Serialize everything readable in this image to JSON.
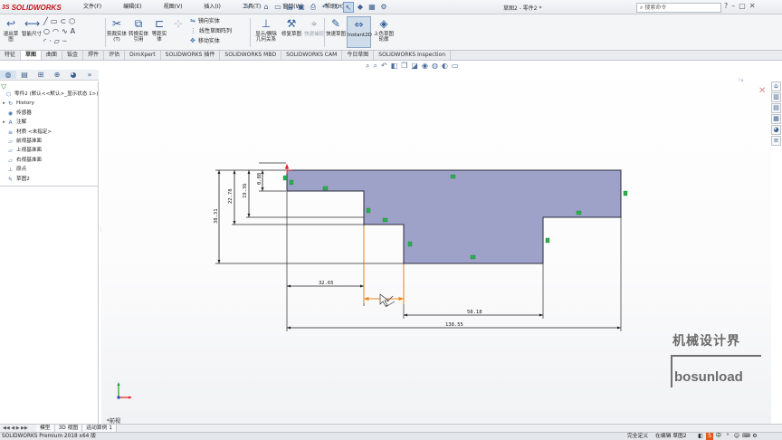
{
  "app": {
    "logo_ds": "3S",
    "logo_text": "SOLIDWORKS",
    "window_title": "草图2 - 零件2 *",
    "search_placeholder": "搜索命令"
  },
  "menu": [
    "文件(F)",
    "编辑(E)",
    "视图(V)",
    "插入(I)",
    "工具(T)",
    "窗口(W)",
    "帮助(H)"
  ],
  "command_manager": {
    "exit_sketch": "退出草图",
    "smart_dimension": "智能尺寸",
    "trim": "剪裁实体(T)",
    "convert": "转换实体引用",
    "offset": "等距实体",
    "mirror": "镜向实体",
    "linear_pattern": "线性草图阵列",
    "move": "移动实体",
    "display_relations": "显示/删除几何关系",
    "repair": "修复草图",
    "quick_snap": "快速捕捉",
    "rapid_sketch": "快速草图",
    "instant2d": "Instant2D",
    "shaded_contours": "上色草图轮廓"
  },
  "tabs": [
    "特征",
    "草图",
    "曲面",
    "钣金",
    "焊件",
    "评估",
    "DimXpert",
    "SOLIDWORKS 插件",
    "SOLIDWORKS MBD",
    "SOLIDWORKS CAM",
    "今日草图",
    "SOLIDWORKS Inspection"
  ],
  "active_tab_index": 1,
  "feature_tree": [
    {
      "label": "零件2 (默认<<默认>_显示状态 1>)",
      "icon": "part-icon",
      "glyph": "⬡",
      "exp": ""
    },
    {
      "label": "History",
      "icon": "history-icon",
      "glyph": "↻",
      "exp": "▸"
    },
    {
      "label": "传感器",
      "icon": "sensor-icon",
      "glyph": "◉",
      "exp": ""
    },
    {
      "label": "注解",
      "icon": "annotation-icon",
      "glyph": "A",
      "exp": "▸"
    },
    {
      "label": "材质 <未指定>",
      "icon": "material-icon",
      "glyph": "≡",
      "exp": ""
    },
    {
      "label": "前视基准面",
      "icon": "plane-icon",
      "glyph": "▱",
      "exp": ""
    },
    {
      "label": "上视基准面",
      "icon": "plane-icon",
      "glyph": "▱",
      "exp": ""
    },
    {
      "label": "右视基准面",
      "icon": "plane-icon",
      "glyph": "▱",
      "exp": ""
    },
    {
      "label": "原点",
      "icon": "origin-icon",
      "glyph": "⊥",
      "exp": ""
    },
    {
      "label": "草图2",
      "icon": "sketch-icon",
      "glyph": "✎",
      "exp": ""
    }
  ],
  "dimensions": {
    "d_0_88": "0.88",
    "d_19_36": "19.36",
    "d_22_78": "22.78",
    "d_38_31": "38.31",
    "d_32_65": "32.65",
    "d_58_18": "58.18",
    "d_138_55": "138.55"
  },
  "watermark": {
    "line1": "机械设计界",
    "line2": "bosunload"
  },
  "view_label": "*前视",
  "bottom_tabs": [
    "模型",
    "3D 视图",
    "运动算例 1"
  ],
  "status": {
    "left": "SOLIDWORKS Premium 2018 x64 版",
    "state": "完全定义",
    "editing": "在编辑 草图2"
  }
}
